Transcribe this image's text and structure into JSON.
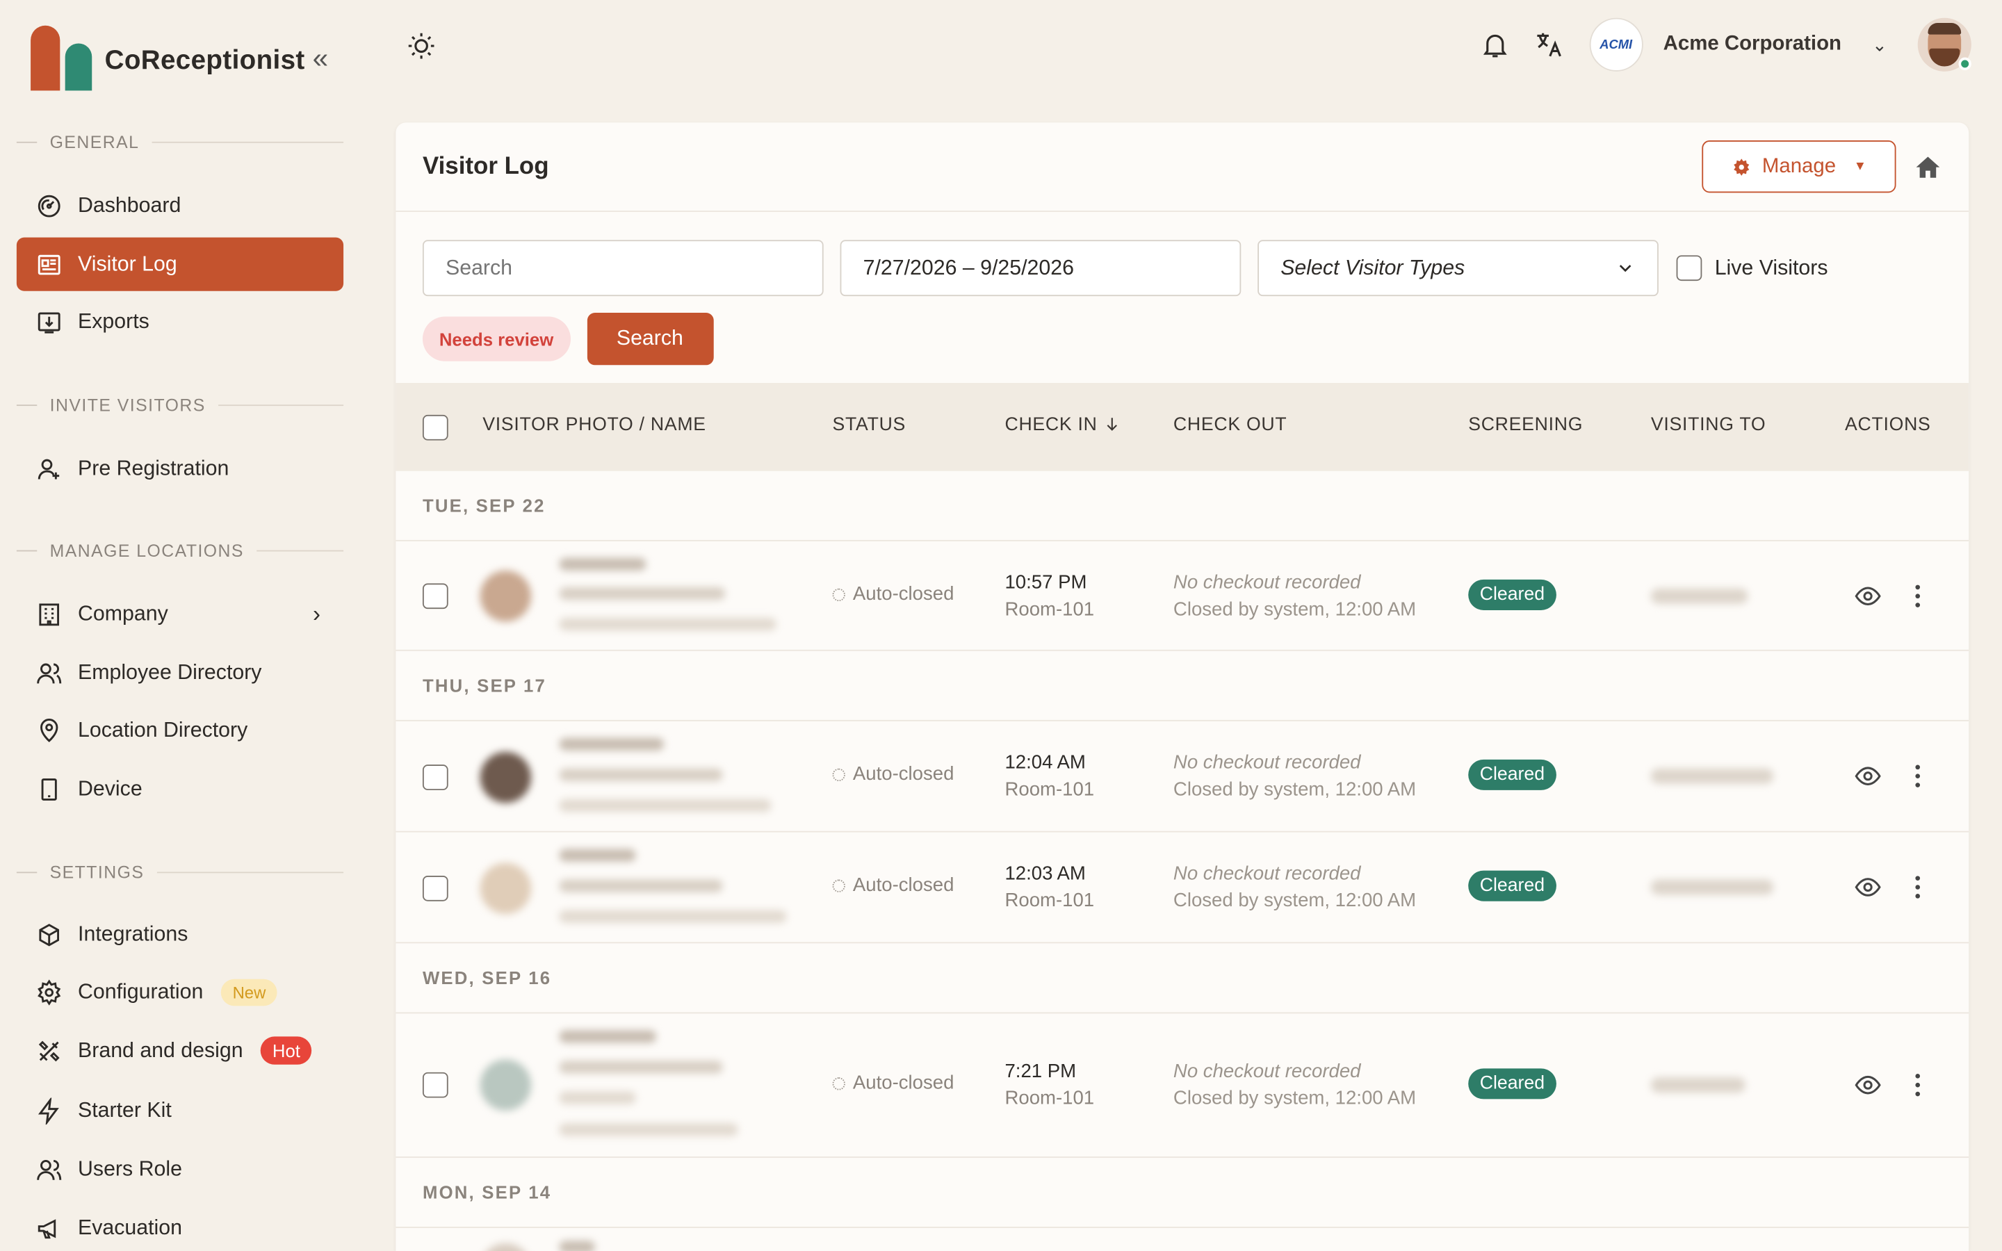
{
  "brand": {
    "name": "CoReceptionist",
    "collapse_glyph": "«"
  },
  "sidebar": {
    "sections": {
      "general": "GENERAL",
      "invite": "INVITE VISITORS",
      "locations": "MANAGE LOCATIONS",
      "settings": "SETTINGS"
    },
    "items": {
      "dashboard": "Dashboard",
      "visitor_log": "Visitor Log",
      "exports": "Exports",
      "pre_registration": "Pre Registration",
      "company": "Company",
      "employee_directory": "Employee Directory",
      "location_directory": "Location Directory",
      "device": "Device",
      "integrations": "Integrations",
      "configuration": "Configuration",
      "configuration_badge": "New",
      "brand_design": "Brand and design",
      "brand_design_badge": "Hot",
      "starter_kit": "Starter Kit",
      "users_role": "Users Role",
      "evacuation": "Evacuation"
    }
  },
  "topbar": {
    "org_logo_text": "ACMI",
    "org_name": "Acme Corporation",
    "org_chevron": "⌄"
  },
  "page": {
    "title": "Visitor Log",
    "manage_label": "Manage",
    "filters": {
      "search_placeholder": "Search",
      "date_range": "7/27/2026 – 9/25/2026",
      "visitor_types_placeholder": "Select Visitor Types",
      "live_visitors_label": "Live Visitors",
      "needs_review": "Needs review",
      "search_button": "Search"
    },
    "columns": {
      "photo_name": "VISITOR PHOTO / NAME",
      "status": "STATUS",
      "check_in": "CHECK IN",
      "check_out": "CHECK OUT",
      "screening": "SCREENING",
      "visiting_to": "VISITING TO",
      "actions": "ACTIONS"
    },
    "groups": [
      "TUE, SEP 22",
      "THU, SEP 17",
      "WED, SEP 16",
      "MON, SEP 14"
    ],
    "rows": [
      {
        "status": "Auto-closed",
        "check_in_time": "10:57 PM",
        "check_in_room": "Room-101",
        "checkout_note": "No checkout recorded",
        "checkout_detail": "Closed by system, 12:00 AM",
        "screening": "Cleared"
      },
      {
        "status": "Auto-closed",
        "check_in_time": "12:04 AM",
        "check_in_room": "Room-101",
        "checkout_note": "No checkout recorded",
        "checkout_detail": "Closed by system, 12:00 AM",
        "screening": "Cleared"
      },
      {
        "status": "Auto-closed",
        "check_in_time": "12:03 AM",
        "check_in_room": "Room-101",
        "checkout_note": "No checkout recorded",
        "checkout_detail": "Closed by system, 12:00 AM",
        "screening": "Cleared"
      },
      {
        "status": "Auto-closed",
        "check_in_time": "7:21 PM",
        "check_in_room": "Room-101",
        "checkout_note": "No checkout recorded",
        "checkout_detail": "Closed by system, 12:00 AM",
        "screening": "Cleared"
      }
    ]
  },
  "colors": {
    "accent": "#c4532e",
    "brand_green": "#2f8a73",
    "cleared": "#2e7d68",
    "background": "#f5f0e8"
  }
}
